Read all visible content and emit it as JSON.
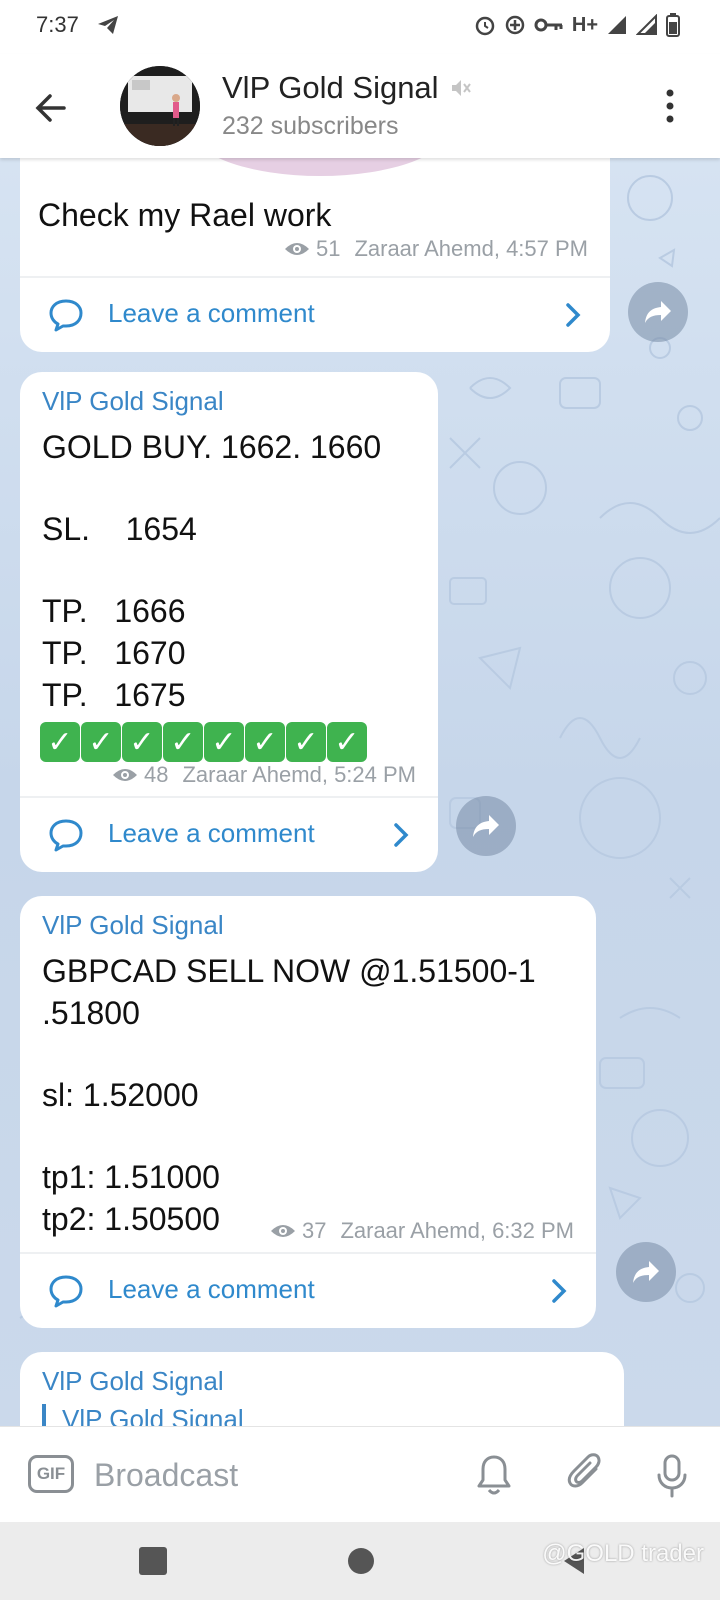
{
  "status": {
    "time": "7:37",
    "network": "H+"
  },
  "header": {
    "title": "VlP Gold Signal",
    "subtitle": "232 subscribers"
  },
  "messages": [
    {
      "text": "Check my Rael work",
      "views": "51",
      "meta": "Zaraar Ahemd, 4:57 PM",
      "comment_label": "Leave a comment"
    },
    {
      "sender": "VlP Gold Signal",
      "lines": [
        "GOLD BUY. 1662. 1660",
        "SL.    1654",
        "TP.   1666",
        "TP.   1670",
        "TP.   1675"
      ],
      "checks": [
        "✓",
        "✓",
        "✓",
        "✓",
        "✓",
        "✓",
        "✓",
        "✓"
      ],
      "views": "48",
      "meta": "Zaraar Ahemd, 5:24 PM",
      "comment_label": "Leave a comment"
    },
    {
      "sender": "VlP Gold Signal",
      "lines": [
        "GBPCAD SELL NOW @1.51500-1",
        ".51800",
        "sl: 1.52000",
        "tp1: 1.51000",
        "tp2: 1.50500"
      ],
      "views": "37",
      "meta": "Zaraar Ahemd, 6:32 PM",
      "comment_label": "Leave a comment"
    },
    {
      "sender": "VlP Gold Signal",
      "reply_to": "VlP Gold Signal"
    }
  ],
  "input": {
    "gif_label": "GIF",
    "placeholder": "Broadcast"
  },
  "watermark": "@GOLD trader",
  "colors": {
    "accent": "#3a86c6",
    "link": "#2f89cc",
    "check": "#3fb34f",
    "chat_bg": "#c9d9ec"
  },
  "icons": [
    "telegram-icon",
    "alarm-icon",
    "key-icon",
    "signal-icon",
    "battery-icon",
    "back-arrow-icon",
    "mute-icon",
    "more-vert-icon",
    "eye-icon",
    "comment-icon",
    "chevron-right-icon",
    "share-icon",
    "gif-icon",
    "bell-icon",
    "paperclip-icon",
    "microphone-icon"
  ]
}
